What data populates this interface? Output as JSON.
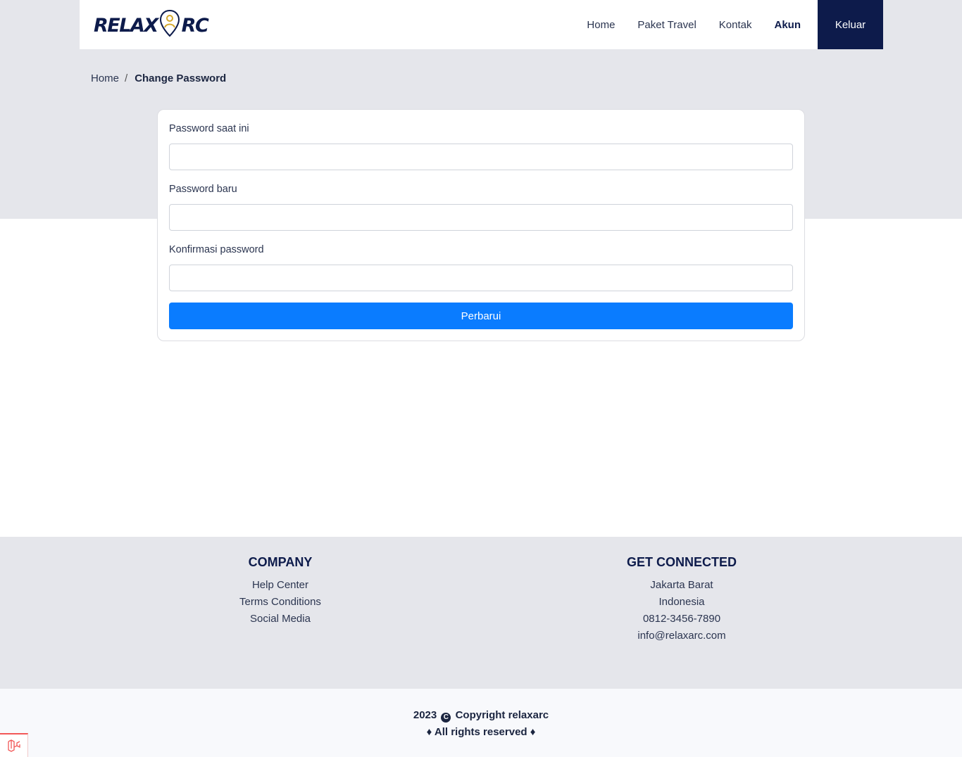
{
  "brand": {
    "logo_left": "RELAX",
    "logo_right": "RC",
    "accent_color": "#0d1b4b",
    "pin_color": "#d4a72c"
  },
  "nav": {
    "items": [
      {
        "label": "Home",
        "active": false
      },
      {
        "label": "Paket Travel",
        "active": false
      },
      {
        "label": "Kontak",
        "active": false
      },
      {
        "label": "Akun",
        "active": true
      }
    ],
    "logout_label": "Keluar"
  },
  "breadcrumb": {
    "home": "Home",
    "separator": "/",
    "current": "Change Password"
  },
  "form": {
    "current_password_label": "Password saat ini",
    "current_password_value": "",
    "new_password_label": "Password baru",
    "new_password_value": "",
    "confirm_password_label": "Konfirmasi password",
    "confirm_password_value": "",
    "submit_label": "Perbarui",
    "submit_color": "#0a7cff"
  },
  "footer": {
    "company": {
      "title": "COMPANY",
      "links": [
        "Help Center",
        "Terms Conditions",
        "Social Media"
      ]
    },
    "connected": {
      "title": "GET CONNECTED",
      "lines": [
        "Jakarta Barat",
        "Indonesia",
        "0812-3456-7890",
        "info@relaxarc.com"
      ]
    }
  },
  "copyright": {
    "year": "2023",
    "icon": "copyright-icon",
    "text": "Copyright relaxarc",
    "rights": "♦ All rights reserved ♦"
  }
}
